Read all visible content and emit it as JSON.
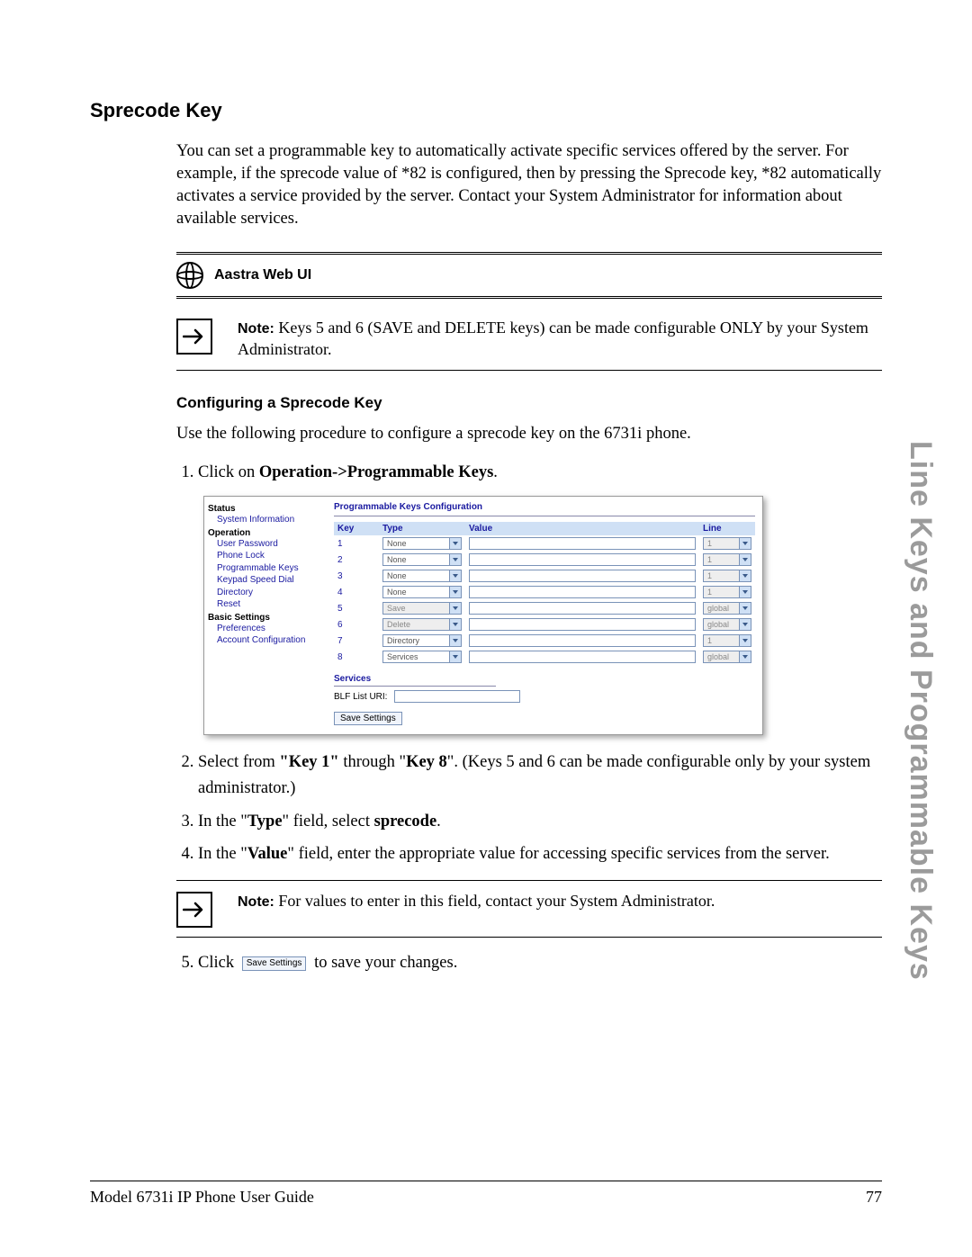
{
  "section_title": "Sprecode Key",
  "intro": "You can set a programmable key to automatically activate specific services offered by the server. For example, if the sprecode value of *82 is configured, then by pressing the Sprecode key, *82 automatically activates a service provided by the server. Contact your System Administrator for information about available services.",
  "ui_header_label": "Aastra Web UI",
  "note1": {
    "label": "Note:",
    "text": " Keys 5 and 6 (SAVE and DELETE keys) can be made configurable ONLY by your System Administrator."
  },
  "subheading": "Configuring a Sprecode Key",
  "body1": "Use the following procedure to configure a sprecode key on the 6731i phone.",
  "steps": {
    "s1_a": "Click on ",
    "s1_b": "Operation->Programmable Keys",
    "s1_c": ".",
    "s2_a": "Select from ",
    "s2_b": "\"Key 1\"",
    "s2_c": " through \"",
    "s2_d": "Key 8",
    "s2_e": "\". (Keys 5 and 6 can be made configurable only by your system administrator.)",
    "s3_a": "In the \"",
    "s3_b": "Type",
    "s3_c": "\" field, select ",
    "s3_d": "sprecode",
    "s3_e": ".",
    "s4_a": "In the \"",
    "s4_b": "Value",
    "s4_c": "\" field, enter the appropriate value for accessing specific services from the server.",
    "s5_a": "Click ",
    "s5_btn": "Save Settings",
    "s5_b": " to save your changes."
  },
  "note2": {
    "label": "Note:",
    "text": " For values to enter in this field, contact your System Administrator."
  },
  "screenshot": {
    "title": "Programmable Keys Configuration",
    "side": {
      "status": "Status",
      "status_items": [
        "System Information"
      ],
      "operation": "Operation",
      "operation_items": [
        "User Password",
        "Phone Lock",
        "Programmable Keys",
        "Keypad Speed Dial",
        "Directory",
        "Reset"
      ],
      "basic": "Basic Settings",
      "basic_items": [
        "Preferences",
        "Account Configuration"
      ]
    },
    "cols": {
      "key": "Key",
      "type": "Type",
      "value": "Value",
      "line": "Line"
    },
    "rows": [
      {
        "key": "1",
        "type": "None",
        "type_disabled": false,
        "line": "1",
        "line_disabled": true
      },
      {
        "key": "2",
        "type": "None",
        "type_disabled": false,
        "line": "1",
        "line_disabled": true
      },
      {
        "key": "3",
        "type": "None",
        "type_disabled": false,
        "line": "1",
        "line_disabled": true
      },
      {
        "key": "4",
        "type": "None",
        "type_disabled": false,
        "line": "1",
        "line_disabled": true
      },
      {
        "key": "5",
        "type": "Save",
        "type_disabled": true,
        "line": "global",
        "line_disabled": true
      },
      {
        "key": "6",
        "type": "Delete",
        "type_disabled": true,
        "line": "global",
        "line_disabled": true
      },
      {
        "key": "7",
        "type": "Directory",
        "type_disabled": false,
        "line": "1",
        "line_disabled": true
      },
      {
        "key": "8",
        "type": "Services",
        "type_disabled": false,
        "line": "global",
        "line_disabled": true
      }
    ],
    "services_header": "Services",
    "blf_label": "BLF List URI:",
    "save_btn": "Save Settings"
  },
  "side_tab": "Line Keys and Programmable Keys",
  "footer": {
    "left": "Model 6731i IP Phone User Guide",
    "right": "77"
  }
}
